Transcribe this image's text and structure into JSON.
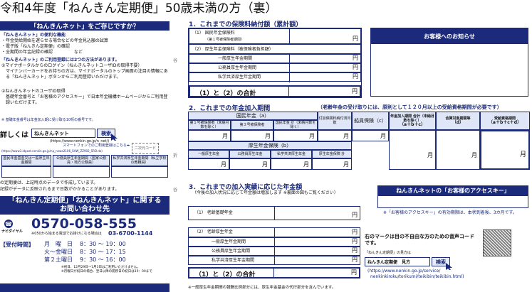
{
  "page_title": "令和4年度「ねんきん定期便」50歳未満の方（裏）",
  "left": {
    "nenkin_net_header": "「ねんきんネット」をご存じですか？",
    "convenience_title": "「ねんきんネット」の便利な機能",
    "features": [
      "・年金受給開始を遅らせる場合などの年金見込額の試算",
      "・電子版「ねんきん定期便」の確認",
      "・全期間の年金記録の確認　　　　　など"
    ],
    "usage_title": "「ねんきんネット」のご利用登録には2つの方法があります。",
    "method1": "①マイナポータルからのログイン（ねんきんネットユーザIDの取得不要）",
    "method1_detail": "マイナンバーカードをお持ちの方は、マイナポータルのトップ画面の注目の情報にある「ねんきんネット」ボタンからご利用登録いただけます。",
    "method2": "②ねんきんネットのユーザID取得",
    "method2_detail": "基礎年金番号と「お客様のアクセスキー」で日本年金機構ホームページからご利用登録いただけます。",
    "access_key_note": "※ 基礎年金番号は年金加入期に受け取る10桁の番号です。",
    "search_prefix": "詳しくは",
    "search_value": "ねんきんネット",
    "search_button": "検索",
    "search_url": "(https://www.nenkin.go.jp/n_net/)",
    "smartphone_note": "スマートフォンでのご利用登録はこちら➡",
    "qr_label": "二次元コード",
    "smartphone_url": "(https://www3.idpost.nenkin.go.jp/np_newa2106_SHW_ZZ902_SRD.do)",
    "fund_headers": [
      "国民年金基金又は一般厚生年金期間",
      "公務員厚生年金期間（国家公務員・地方公務員）",
      "私学共済厚生年金期間（私立学校の教職員）"
    ],
    "note_lines": [
      "の定期便は、上記時点のデータで作成しています。",
      "記録がデータに反映されるまで日数がかかることがあります。"
    ],
    "contact_title": "「ねんきん定期便」「ねんきんネット」に関する お問い合わせ先",
    "dial_logo": "ナビダイヤル",
    "phone": "0570-058-555",
    "ip_phone_note": "※050から始まる電話でお掛けになる場合は",
    "ip_phone": "03-6700-1144",
    "hours_label": "【受付時間】",
    "hours": [
      {
        "day": "月　曜　日",
        "time": "8：30 〜 19：00"
      },
      {
        "day": "火〜金曜日",
        "time": "8：30 〜 17：15"
      },
      {
        "day": "第２土曜日",
        "time": "9：30 〜 16：00"
      }
    ],
    "hours_note": "※祝日、12月29日〜1月3日はご利用いただけません。",
    "hours_note2": "※月曜日が祝日の場合、翌日以降の開所日の初日は19：00まで"
  },
  "section1": {
    "title": "1．これまでの保険料納付額（累計額）",
    "rows": [
      {
        "label": "（1） 国民年金保険料",
        "sub": "（第１号被保険者期間）",
        "unit": "円"
      },
      {
        "label": "（2） 厚生年金保険料（被保険者負担額）",
        "sub": "",
        "unit": "円"
      },
      {
        "label": "一般厚生年金期間",
        "sub": "",
        "unit": "円"
      },
      {
        "label": "公務員厚生年金期間",
        "sub": "",
        "unit": "円"
      },
      {
        "label": "私学共済厚生年金期間",
        "sub": "",
        "unit": "円"
      }
    ],
    "total_label": "（1）と（2）の合計",
    "total_unit": "円"
  },
  "notice_title": "お客様へのお知らせ",
  "section2": {
    "title": "2．これまでの年金加入期間",
    "title_note": "（老齢年金の受け取りには、原則として１２０月以上の受給資格期間が必要です）",
    "kokumin_header": "国民年金（a）",
    "kokumin_cols": [
      "第１号被保険者（未納月数を除く）",
      "第３号被保険者",
      "国民年金 計（未納月数を除く）"
    ],
    "fuka_label": "付加保険料納付済月数",
    "senin_label": "船員保険（c）",
    "kanyu_total_label": "年金加入期間 合計（未納月数を除く）",
    "kanyu_total_formula": "（a＋b＋c）",
    "godo_label": "合算対象期間等",
    "godo_formula": "（d）",
    "jukyu_label": "受給資格期間",
    "jukyu_formula": "（a＋b＋c＋d）",
    "kosei_header": "厚生年金保険（b）",
    "kosei_cols": [
      "一般厚生年金",
      "公務員厚生年金",
      "私学共済厚生年金",
      "厚生年金保険 計"
    ],
    "month": "月"
  },
  "section3": {
    "title": "3．これまでの加入実績に応じた年金額",
    "subtitle": "（今後の加入状況に応じて年金額は増加します ※裏面の図もご覧ください）",
    "rows": [
      {
        "label": "（1） 老齢基礎年金",
        "unit": "円"
      },
      {
        "label": "（2） 老齢厚生年金",
        "unit": "円"
      },
      {
        "label": "一般厚生年金期間",
        "unit": "円"
      },
      {
        "label": "公務員厚生年金期間",
        "unit": "円"
      },
      {
        "label": "私学共済厚生年金期間",
        "unit": "円"
      }
    ],
    "total_label": "（1）と（2）の合計",
    "total_unit": "円",
    "footnote": "※一般厚生年金期間の報酬比例部分には、厚生年金基金の代行部分を含んでいます。"
  },
  "access_key": {
    "title": "ねんきんネットの「お客様のアクセスキー」",
    "note": "※「お客様のアクセスキー」の有効期限は、本状到着後、3カ月です。"
  },
  "voice_code": {
    "text": "右のマークは目の不自由な方のための音声コードです。",
    "howto_label": "「ねんきん定期便」の見方は",
    "search_value": "ねんきん定期便　見方",
    "search_button": "検索",
    "url1": "(https://www.nenkin.go.jp/service/",
    "url2": "nenkinkiroku/torikumi/teikibin/teikibin.html)"
  },
  "side_marks": {
    "fold": "谷",
    "cut": "折"
  }
}
